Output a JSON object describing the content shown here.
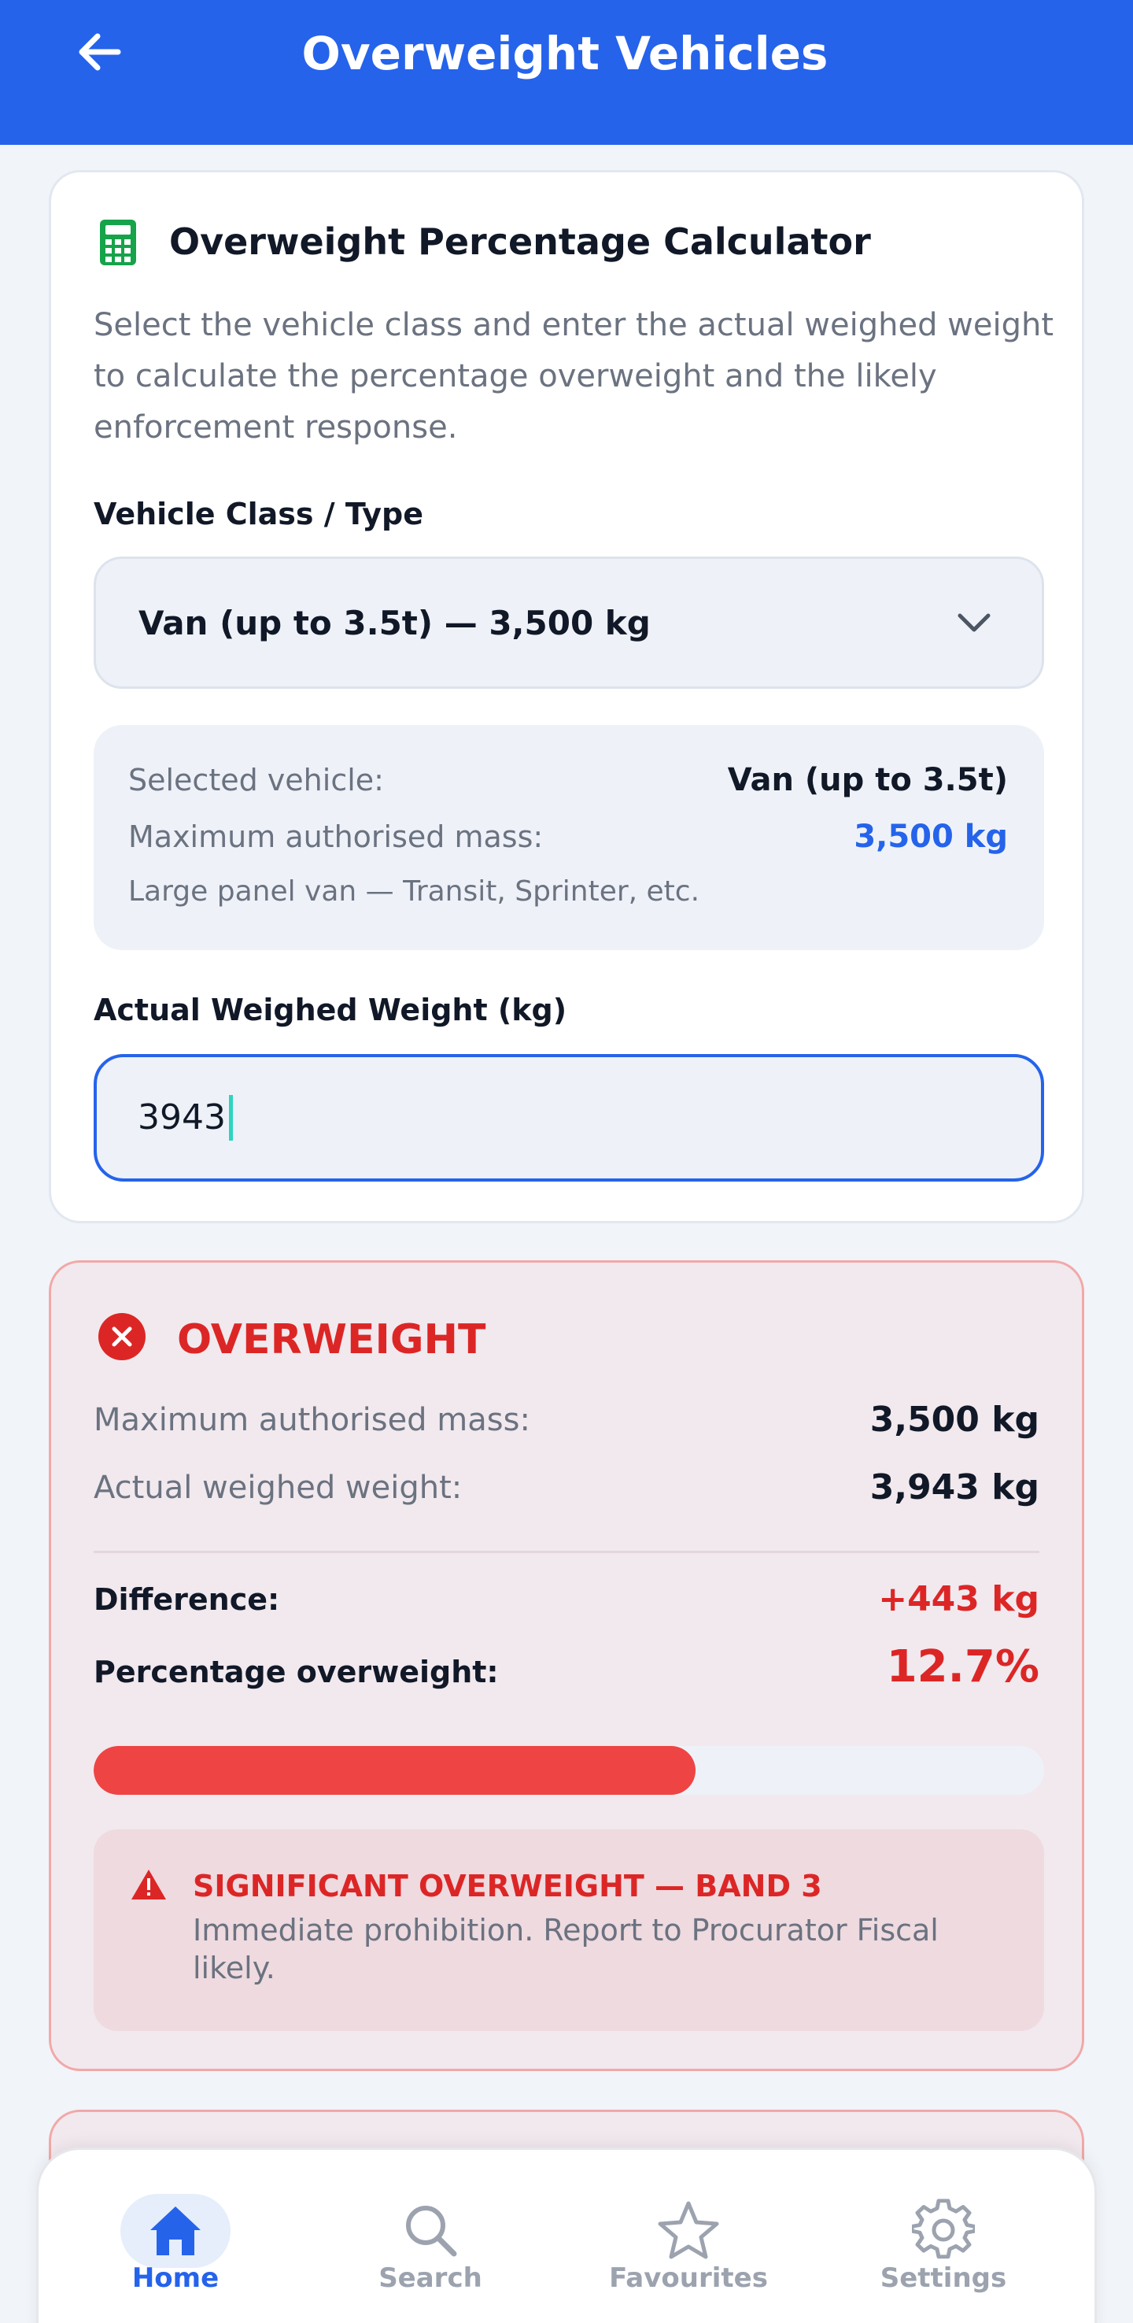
{
  "header": {
    "title": "Overweight Vehicles"
  },
  "calculator": {
    "title": "Overweight Percentage Calculator",
    "description": "Select the vehicle class and enter the actual weighed weight to calculate the percentage overweight and the likely enforcement response.",
    "vehicle_label": "Vehicle Class / Type",
    "vehicle_selected": "Van (up to 3.5t) — 3,500 kg",
    "info": {
      "selected_label": "Selected vehicle:",
      "selected_value": "Van (up to 3.5t)",
      "mam_label": "Maximum authorised mass:",
      "mam_value": "3,500 kg",
      "note": "Large panel van — Transit, Sprinter, etc."
    },
    "weight_label": "Actual Weighed Weight (kg)",
    "weight_value": "3943"
  },
  "result": {
    "status": "OVERWEIGHT",
    "mam_label": "Maximum authorised mass:",
    "mam_value": "3,500 kg",
    "actual_label": "Actual weighed weight:",
    "actual_value": "3,943 kg",
    "difference_label": "Difference:",
    "difference_value": "+443 kg",
    "percentage_label": "Percentage overweight:",
    "percentage_value": "12.7%",
    "progress_fraction": 0.633,
    "warning_title": "SIGNIFICANT OVERWEIGHT — BAND 3",
    "warning_body": "Immediate prohibition. Report to Procurator Fiscal likely."
  },
  "nav": {
    "items": [
      {
        "label": "Home",
        "icon": "home-icon",
        "active": true
      },
      {
        "label": "Search",
        "icon": "search-icon",
        "active": false
      },
      {
        "label": "Favourites",
        "icon": "star-icon",
        "active": false
      },
      {
        "label": "Settings",
        "icon": "gear-icon",
        "active": false
      }
    ]
  },
  "colors": {
    "primary": "#2563eb",
    "danger": "#dc2626",
    "progress": "#ef4444",
    "calculator_icon": "#16a34a"
  }
}
